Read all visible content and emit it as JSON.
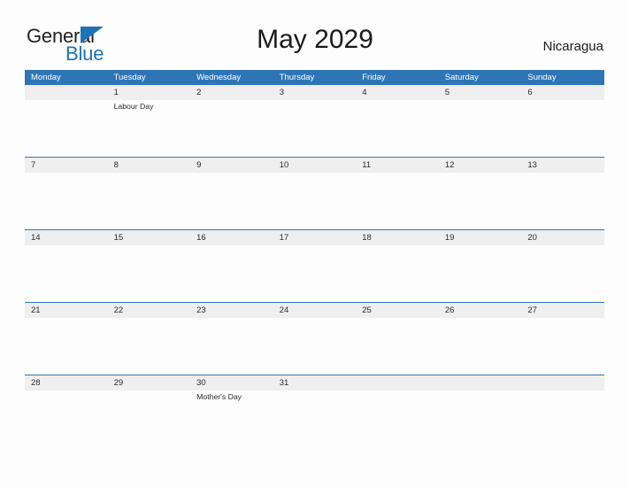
{
  "brand": {
    "name_part1": "General",
    "name_part2": "Blue",
    "flag_icon": "blue-flag-triangle-icon",
    "colors": {
      "dark": "#231f20",
      "blue": "#1d72b8"
    }
  },
  "header": {
    "title": "May 2029",
    "country": "Nicaragua"
  },
  "calendar": {
    "month": "May",
    "year": "2029",
    "accent_color": "#2e75b6",
    "datenum_row_color": "#efefef",
    "weekdays": [
      "Monday",
      "Tuesday",
      "Wednesday",
      "Thursday",
      "Friday",
      "Saturday",
      "Sunday"
    ],
    "weeks": [
      {
        "days": [
          {
            "date": "",
            "events": []
          },
          {
            "date": "1",
            "events": [
              "Labour Day"
            ]
          },
          {
            "date": "2",
            "events": []
          },
          {
            "date": "3",
            "events": []
          },
          {
            "date": "4",
            "events": []
          },
          {
            "date": "5",
            "events": []
          },
          {
            "date": "6",
            "events": []
          }
        ]
      },
      {
        "days": [
          {
            "date": "7",
            "events": []
          },
          {
            "date": "8",
            "events": []
          },
          {
            "date": "9",
            "events": []
          },
          {
            "date": "10",
            "events": []
          },
          {
            "date": "11",
            "events": []
          },
          {
            "date": "12",
            "events": []
          },
          {
            "date": "13",
            "events": []
          }
        ]
      },
      {
        "days": [
          {
            "date": "14",
            "events": []
          },
          {
            "date": "15",
            "events": []
          },
          {
            "date": "16",
            "events": []
          },
          {
            "date": "17",
            "events": []
          },
          {
            "date": "18",
            "events": []
          },
          {
            "date": "19",
            "events": []
          },
          {
            "date": "20",
            "events": []
          }
        ]
      },
      {
        "days": [
          {
            "date": "21",
            "events": []
          },
          {
            "date": "22",
            "events": []
          },
          {
            "date": "23",
            "events": []
          },
          {
            "date": "24",
            "events": []
          },
          {
            "date": "25",
            "events": []
          },
          {
            "date": "26",
            "events": []
          },
          {
            "date": "27",
            "events": []
          }
        ]
      },
      {
        "days": [
          {
            "date": "28",
            "events": []
          },
          {
            "date": "29",
            "events": []
          },
          {
            "date": "30",
            "events": [
              "Mother's Day"
            ]
          },
          {
            "date": "31",
            "events": []
          },
          {
            "date": "",
            "events": []
          },
          {
            "date": "",
            "events": []
          },
          {
            "date": "",
            "events": []
          }
        ]
      }
    ]
  }
}
